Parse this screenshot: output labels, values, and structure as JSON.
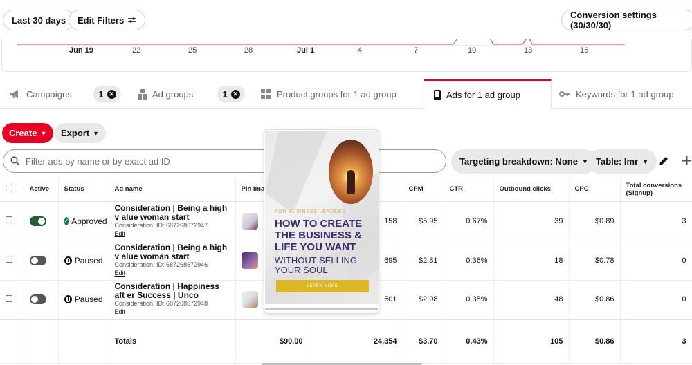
{
  "toolbar": {
    "date_range": "Last 30 days",
    "edit_filters": "Edit Filters",
    "conversion_settings": "Conversion settings (30/30/30)"
  },
  "chart_axis": {
    "ticks": [
      "Jun 19",
      "22",
      "25",
      "28",
      "Jul 1",
      "4",
      "7",
      "10",
      "13",
      "16"
    ]
  },
  "tabs": [
    {
      "label": "Campaigns",
      "icon": "megaphone-icon"
    },
    {
      "label": "Ad groups",
      "icon": "ad-group-icon"
    },
    {
      "label": "Product groups for 1 ad group",
      "icon": "grid-icon"
    },
    {
      "label": "Ads for 1 ad group",
      "icon": "phone-icon",
      "active": true
    },
    {
      "label": "Keywords for 1 ad group",
      "icon": "key-icon"
    }
  ],
  "filter_counts": [
    "1",
    "1"
  ],
  "actions": {
    "create": "Create",
    "export": "Export"
  },
  "search": {
    "placeholder": "Filter ads by name or by exact ad ID"
  },
  "view": {
    "targeting": "Targeting breakdown: None",
    "table": "Table: Imr"
  },
  "table": {
    "headers": [
      "Active",
      "Status",
      "Ad name",
      "Pin ima",
      "",
      "CPM",
      "CTR",
      "Outbound clicks",
      "CPC",
      "Total conversions (Signup)"
    ],
    "rows": [
      {
        "active": true,
        "status": "Approved",
        "name": "Consideration | Being a high v alue woman start",
        "sub": "Consideration, ID: 687268672947",
        "edit": "Edit",
        "col5": "158",
        "cpm": "$5.95",
        "ctr": "0.67%",
        "clicks": "39",
        "cpc": "$0.89",
        "conv": "3"
      },
      {
        "active": false,
        "status": "Paused",
        "name": "Consideration | Being a high v alue woman start",
        "sub": "Consideration, ID: 687268672946",
        "edit": "Edit",
        "col5": "695",
        "cpm": "$2.81",
        "ctr": "0.36%",
        "clicks": "18",
        "cpc": "$0.78",
        "conv": "0"
      },
      {
        "active": false,
        "status": "Paused",
        "name": "Consideration | Happiness aft er Success | Unco",
        "sub": "Consideration, ID: 687268672948",
        "edit": "Edit",
        "col5": "501",
        "cpm": "$2.98",
        "ctr": "0.35%",
        "clicks": "48",
        "cpc": "$0.86",
        "conv": "0"
      }
    ],
    "totals": {
      "label": "Totals",
      "spend": "$90.00",
      "impressions": "24,354",
      "cpm": "$3.70",
      "ctr": "0.43%",
      "clicks": "105",
      "cpc": "$0.86",
      "conv": "3"
    }
  },
  "preview": {
    "kicker": "FOR BUSINESS LEADERS",
    "title": "HOW TO CREATE THE BUSINESS & LIFE YOU WANT",
    "subtitle": "WITHOUT SELLING YOUR SOUL",
    "cta": "LEARN MORE"
  },
  "colors": {
    "brand": "#e60023",
    "toggle_on": "#235d3a",
    "approved": "#0a7d3b",
    "cta": "#dcb625",
    "title": "#3d2a6b"
  }
}
